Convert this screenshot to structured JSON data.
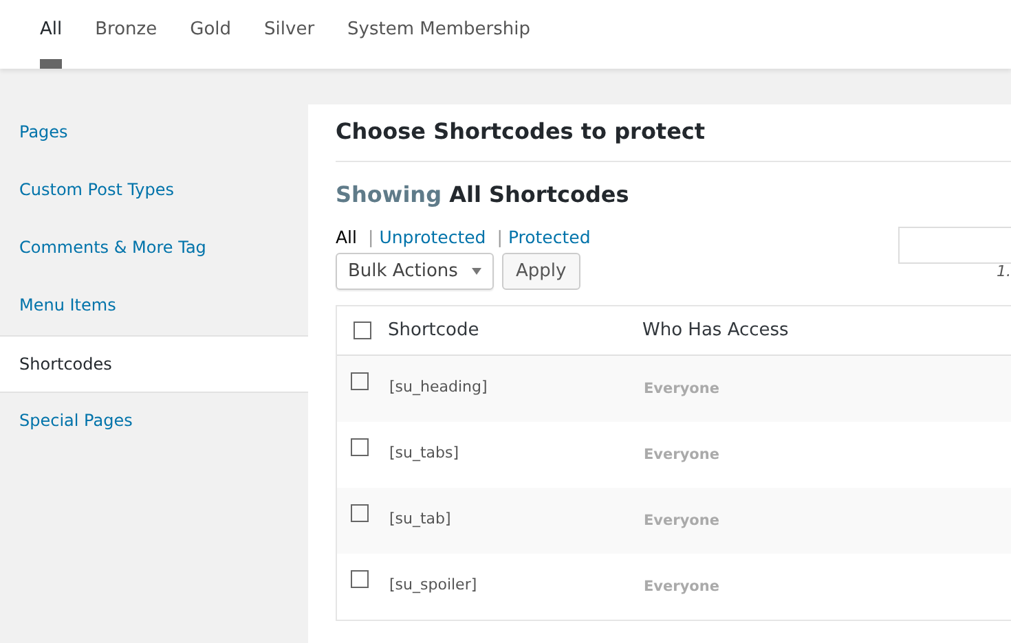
{
  "tabs": [
    {
      "label": "All",
      "selected": true
    },
    {
      "label": "Bronze",
      "selected": false
    },
    {
      "label": "Gold",
      "selected": false
    },
    {
      "label": "Silver",
      "selected": false
    },
    {
      "label": "System Membership",
      "selected": false
    }
  ],
  "sidebar": {
    "items": [
      {
        "label": "Pages",
        "selected": false
      },
      {
        "label": "Custom Post Types",
        "selected": false
      },
      {
        "label": "Comments & More Tag",
        "selected": false
      },
      {
        "label": "Menu Items",
        "selected": false
      },
      {
        "label": "Shortcodes",
        "selected": true
      },
      {
        "label": "Special Pages",
        "selected": false
      }
    ]
  },
  "panel": {
    "title": "Choose Shortcodes to protect",
    "heading": "Showing **All Shortcodes**",
    "filters": [
      {
        "label": "All",
        "selected": true
      },
      {
        "separator": "|",
        "label": "Unprotected",
        "selected": false
      },
      {
        "separator": "|",
        "label": "Protected",
        "selected": false
      }
    ],
    "bulk_actions": "Bulk Actions",
    "apply": "Apply",
    "item_count": "1.",
    "table": {
      "select_all_checked": false,
      "columns": [
        "Shortcode",
        "Who Has Access"
      ],
      "rows": [
        {
          "shortcode": "[su_heading]",
          "access": "Everyone",
          "checked": false
        },
        {
          "shortcode": "[su_tabs]",
          "access": "Everyone",
          "checked": false
        },
        {
          "shortcode": "[su_tab]",
          "access": "Everyone",
          "checked": false
        },
        {
          "shortcode": "[su_spoiler]",
          "access": "Everyone",
          "checked": false
        }
      ]
    }
  }
}
